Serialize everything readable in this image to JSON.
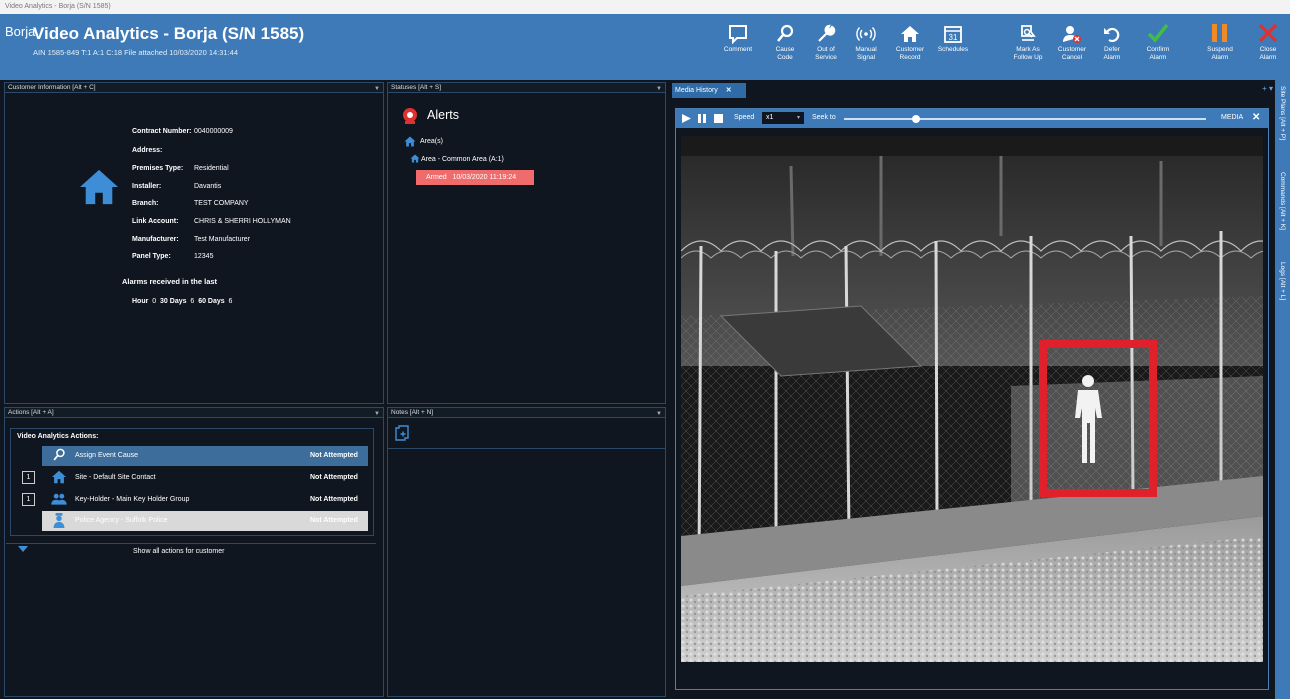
{
  "window": {
    "title": "Video Analytics - Borja (S/N 1585)"
  },
  "header": {
    "title": "Video Analytics - Borja (S/N 1585)",
    "subtitle": "AIN 1585-849  T:1 A:1 C:18 File attached  10/03/2020 14:31:44",
    "toolbar": [
      {
        "label": "Comment",
        "icon": "comment-icon"
      },
      {
        "label": "Cause\nCode",
        "icon": "search-icon"
      },
      {
        "label": "Out of\nService",
        "icon": "wrench-icon"
      },
      {
        "label": "Manual\nSignal",
        "icon": "signal-icon"
      },
      {
        "label": "Customer\nRecord",
        "icon": "home-icon"
      },
      {
        "label": "Schedules",
        "icon": "calendar-icon"
      },
      {
        "label": "Mark As\nFollow Up",
        "icon": "followup-icon"
      },
      {
        "label": "Customer\nCancel",
        "icon": "user-cancel-icon"
      },
      {
        "label": "Defer\nAlarm",
        "icon": "undo-icon"
      },
      {
        "label": "Confirm\nAlarm",
        "icon": "check-icon"
      },
      {
        "label": "Suspend\nAlarm",
        "icon": "pause-icon"
      },
      {
        "label": "Close\nAlarm",
        "icon": "close-icon"
      }
    ],
    "calendar_day": "31"
  },
  "customer_panel": {
    "title": "Customer Information [Alt + C]",
    "name": "Borja",
    "fields": [
      {
        "label": "Contract Number:",
        "value": "0040000009"
      },
      {
        "label": "Address:",
        "value": ""
      },
      {
        "label": "Premises Type:",
        "value": "Residential"
      },
      {
        "label": "Installer:",
        "value": "Davantis"
      },
      {
        "label": "Branch:",
        "value": "TEST COMPANY"
      },
      {
        "label": "Link Account:",
        "value": "CHRIS & SHERRI HOLLYMAN"
      },
      {
        "label": "Manufacturer:",
        "value": "Test Manufacturer"
      },
      {
        "label": "Panel Type:",
        "value": "12345"
      }
    ],
    "alarms_heading": "Alarms received in the last",
    "alarm_counts": [
      {
        "label": "Hour",
        "value": "0"
      },
      {
        "label": "30 Days",
        "value": "6"
      },
      {
        "label": "60 Days",
        "value": "6"
      }
    ]
  },
  "statuses_panel": {
    "title": "Statuses [Alt + S]",
    "alerts_title": "Alerts",
    "areas_label": "Area(s)",
    "area_item": "Area - Common Area (A:1)",
    "status_badge": {
      "state": "Armed",
      "time": "10/03/2020 11:19:24"
    }
  },
  "actions_panel": {
    "title": "Actions [Alt + A]",
    "group_title": "Video Analytics Actions:",
    "rows": [
      {
        "number": "",
        "label": "Assign Event Cause",
        "status": "Not Attempted",
        "icon": "search-icon"
      },
      {
        "number": "1",
        "label": "Site - Default Site Contact",
        "status": "Not Attempted",
        "icon": "home-icon"
      },
      {
        "number": "1",
        "label": "Key-Holder - Main Key Holder Group",
        "status": "Not Attempted",
        "icon": "group-icon"
      },
      {
        "number": "",
        "label": "Police Agency - Suffolk Police",
        "status": "Not Attempted",
        "icon": "police-icon"
      }
    ],
    "show_all": "Show all actions for customer"
  },
  "notes_panel": {
    "title": "Notes [Alt + N]"
  },
  "media_panel": {
    "tab_label": "Media History",
    "speed_label": "Speed",
    "speed_value": "x1",
    "seek_label": "Seek to",
    "seek_position": 0.2,
    "media_label": "MEDIA"
  },
  "right_rail": [
    "Site Plans [Alt + P]",
    "Commands [Alt + K]",
    "Logs [Alt + L]"
  ],
  "colors": {
    "header": "#3d7ab7",
    "alarm_red": "#f06b6b",
    "detection_box": "#e0202a",
    "confirm_green": "#3fbf3f",
    "suspend_orange": "#f08a24",
    "close_red": "#e0302f"
  }
}
